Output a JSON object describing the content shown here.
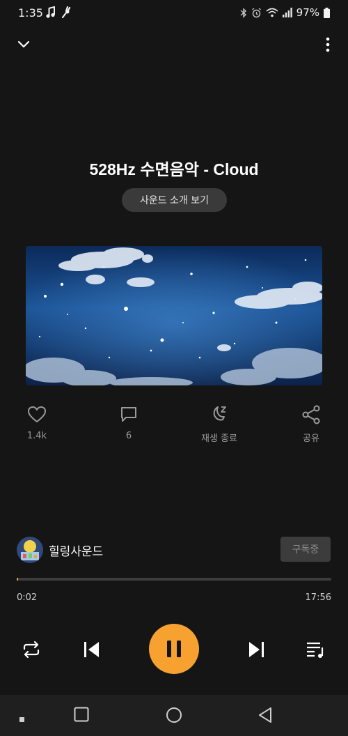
{
  "status_bar": {
    "time": "1:35",
    "battery": "97%",
    "left_icons": [
      "music-note-icon",
      "tuning-fork-icon"
    ],
    "right_icons": [
      "bluetooth-icon",
      "alarm-icon",
      "wifi-icon",
      "signal-icon",
      "battery-icon"
    ]
  },
  "header": {
    "collapse_icon": "chevron-down-icon",
    "more_icon": "more-vertical-icon"
  },
  "track": {
    "title": "528Hz 수면음악 - Cloud",
    "intro_button": "사운드 소개 보기"
  },
  "actions": {
    "like": {
      "icon": "heart-icon",
      "label": "1.4k"
    },
    "comment": {
      "icon": "comment-icon",
      "label": "6"
    },
    "sleep_timer": {
      "icon": "moon-zz-icon",
      "label": "재생 종료"
    },
    "share": {
      "icon": "share-icon",
      "label": "공유"
    }
  },
  "channel": {
    "name": "힐링사운드",
    "subscribe_label": "구독중"
  },
  "progress": {
    "elapsed": "0:02",
    "total": "17:56",
    "fraction": 0.002
  },
  "controls": {
    "repeat_icon": "repeat-icon",
    "previous_icon": "skip-previous-icon",
    "pause_icon": "pause-icon",
    "next_icon": "skip-next-icon",
    "queue_icon": "playlist-icon"
  },
  "colors": {
    "background": "#151515",
    "accent": "#f7a230",
    "muted_text": "#9a9a9a"
  }
}
